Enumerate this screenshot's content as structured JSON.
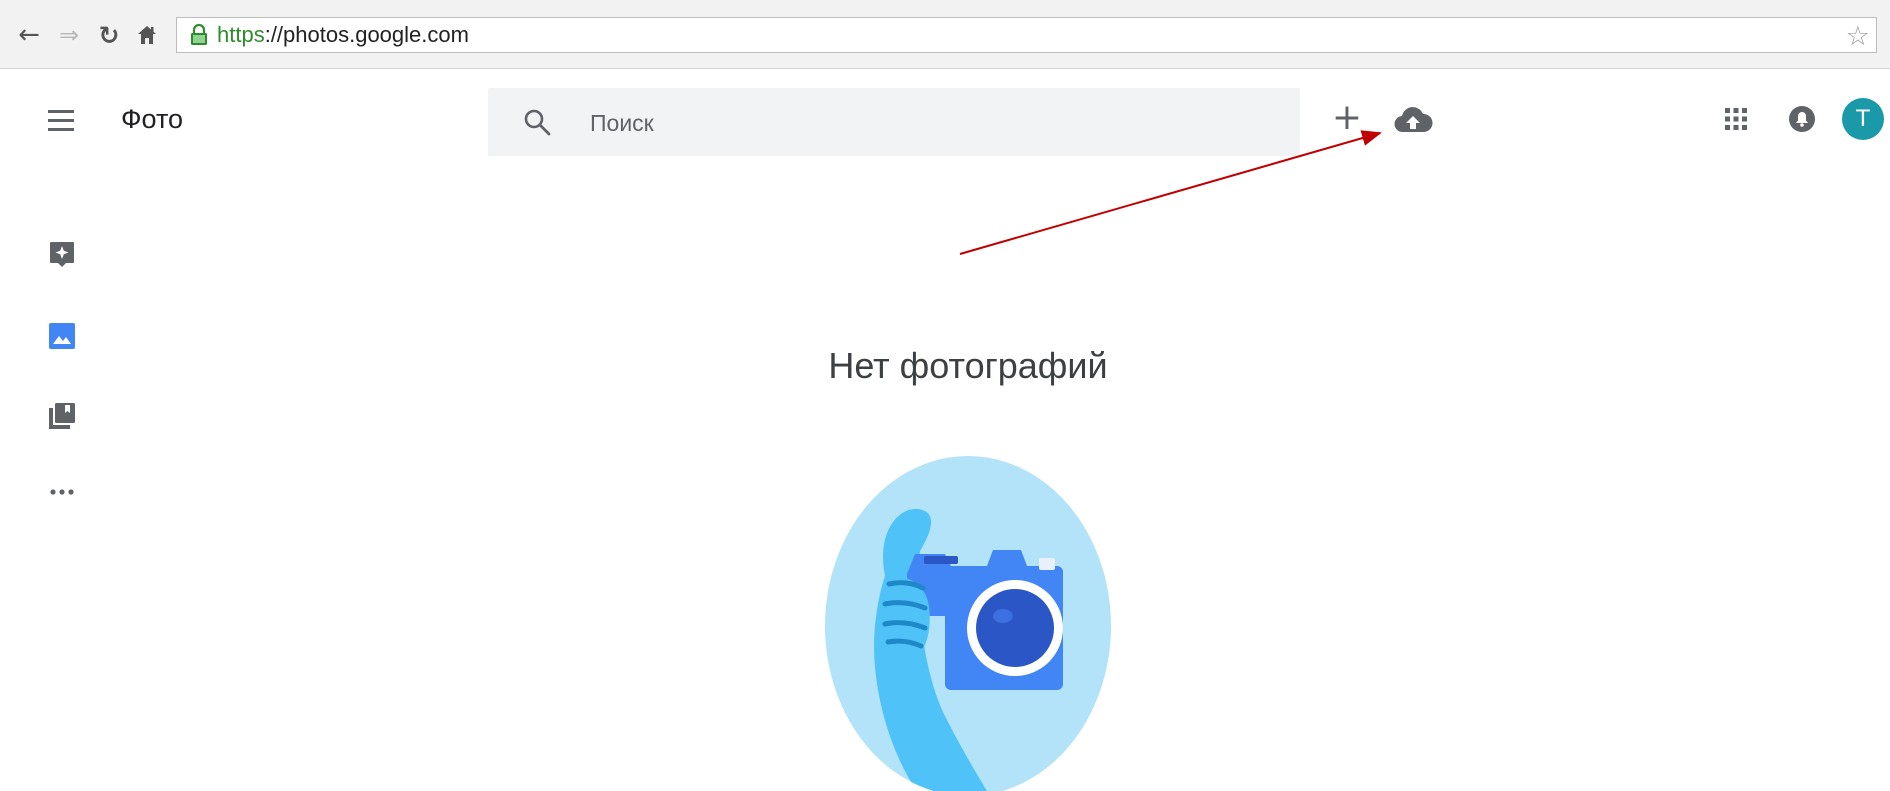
{
  "browser": {
    "url_scheme": "https",
    "url_rest": "://photos.google.com",
    "back_icon": "arrow-left-icon",
    "forward_icon": "arrow-right-icon",
    "reload_icon": "reload-icon",
    "home_icon": "home-icon",
    "bookmark_icon": "star-outline-icon"
  },
  "header": {
    "app_title": "Фото",
    "search_placeholder": "Поиск",
    "create_icon": "plus-icon",
    "upload_icon": "cloud-upload-icon",
    "apps_icon": "apps-grid-icon",
    "notifications_icon": "bell-icon",
    "avatar_letter": "T"
  },
  "sidebar": {
    "items": [
      {
        "icon": "assistant-icon"
      },
      {
        "icon": "photos-icon"
      },
      {
        "icon": "albums-icon"
      },
      {
        "icon": "more-icon"
      }
    ]
  },
  "main": {
    "empty_title": "Нет фотографий",
    "illustration": "hand-holding-camera-illustration"
  },
  "colors": {
    "accent_blue": "#4285f4",
    "avatar_bg": "#1a9aa8",
    "annotation_arrow": "#c00000",
    "illustration_bg": "#b3e3f8"
  }
}
